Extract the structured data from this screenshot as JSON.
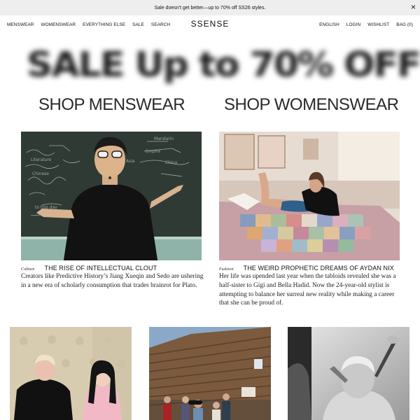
{
  "banner": {
    "text": "Sale doesn't get better—up to 70% off SS26 styles.",
    "close_glyph": "×"
  },
  "nav": {
    "left": [
      "MENSWEAR",
      "WOMENSWEAR",
      "EVERYTHING ELSE",
      "SALE",
      "SEARCH"
    ],
    "logo": "SSENSE",
    "right": [
      "ENGLISH",
      "LOGIN",
      "WISHLIST",
      "BAG (0)"
    ]
  },
  "hero": {
    "text": "SALE Up to 70% OFF"
  },
  "shop": {
    "menswear": "SHOP MENSWEAR",
    "womenswear": "SHOP WOMENSWEAR"
  },
  "articles": [
    {
      "category": "Culture",
      "title": "THE RISE OF INTELLECTUAL CLOUT",
      "blurb": "Creators like Predictive History’s Jiang Xueqin and Sedo are ushering in a new era of scholarly consumption that trades brainrot for Plato."
    },
    {
      "category": "Fashion",
      "title": "THE WEIRD PROPHETIC DREAMS OF AYDAN NIX",
      "blurb": "Her life was upended last year when the tabloids revealed she was a half-sister to Gigi and Bella Hadid. Now the 24-year-old stylist is attempting to balance her surreal new reality while making a career that she can be proud of."
    }
  ],
  "colors": {
    "banner_bg": "#eeeeee",
    "text": "#111111",
    "chalkboard": "#2f3a35"
  },
  "icons": {
    "close": "close-icon"
  }
}
